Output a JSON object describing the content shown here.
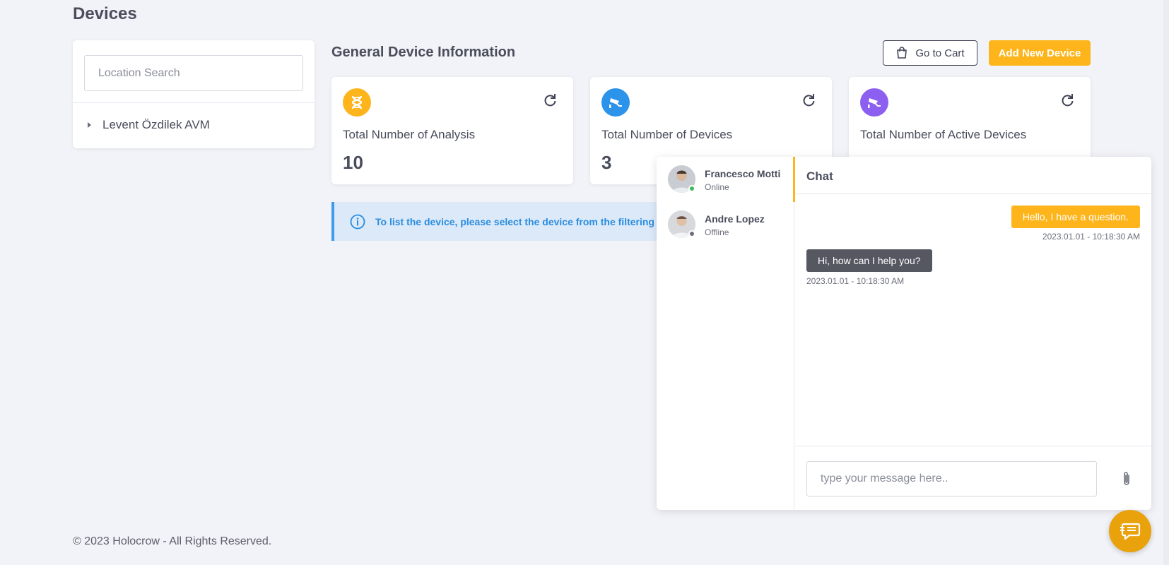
{
  "page": {
    "title": "Devices",
    "footer": "© 2023 Holocrow - All Rights Reserved."
  },
  "location": {
    "search_placeholder": "Location Search",
    "tree": [
      {
        "label": "Levent Özdilek AVM"
      }
    ]
  },
  "general": {
    "title": "General Device Information",
    "cart_label": "Go to Cart",
    "add_label": "Add New Device"
  },
  "stats": [
    {
      "label": "Total Number of Analysis",
      "value": "10",
      "icon": "dna-icon",
      "color": "#fdb51b"
    },
    {
      "label": "Total Number of Devices",
      "value": "3",
      "icon": "camera-icon",
      "color": "#2c93ea"
    },
    {
      "label": "Total Number of Active Devices",
      "value": "",
      "icon": "camera-icon",
      "color": "#8c5ff0"
    }
  ],
  "info": {
    "text": "To list the device, please select the device from the filtering"
  },
  "chat": {
    "title": "Chat",
    "contacts": [
      {
        "name": "Francesco Motti",
        "status": "Online",
        "status_color": "#3dbb5c"
      },
      {
        "name": "Andre Lopez",
        "status": "Offline",
        "status_color": "#6b6e7a"
      }
    ],
    "messages": [
      {
        "direction": "out",
        "text": "Hello, I have a question.",
        "time": "2023.01.01 - 10:18:30 AM"
      },
      {
        "direction": "in",
        "text": "Hi, how can I help you?",
        "time": "2023.01.01 - 10:18:30 AM"
      }
    ],
    "composer_placeholder": "type your message here.."
  }
}
